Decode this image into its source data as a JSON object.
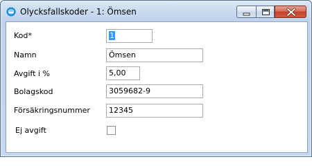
{
  "window": {
    "title": "Olycksfallskoder - 1: Ömsen",
    "app_icon": "app-icon",
    "controls": [
      "minimize-icon",
      "maximize-icon",
      "close-icon"
    ]
  },
  "form": {
    "kod": {
      "label": "Kod*",
      "value": "1"
    },
    "namn": {
      "label": "Namn",
      "value": "Ömsen"
    },
    "avgift": {
      "label": "Avgift i %",
      "value": "5,00"
    },
    "bolagskod": {
      "label": "Bolagskod",
      "value": "3059682-9"
    },
    "forsakringsnummer": {
      "label": "Försäkringsnummer",
      "value": "12345"
    },
    "ej_avgift": {
      "label": "Ej avgift",
      "checked": false
    }
  },
  "colors": {
    "selection": "#3399ff",
    "close_button": "#c2442a",
    "title_gradient": "#bfd3ec"
  }
}
